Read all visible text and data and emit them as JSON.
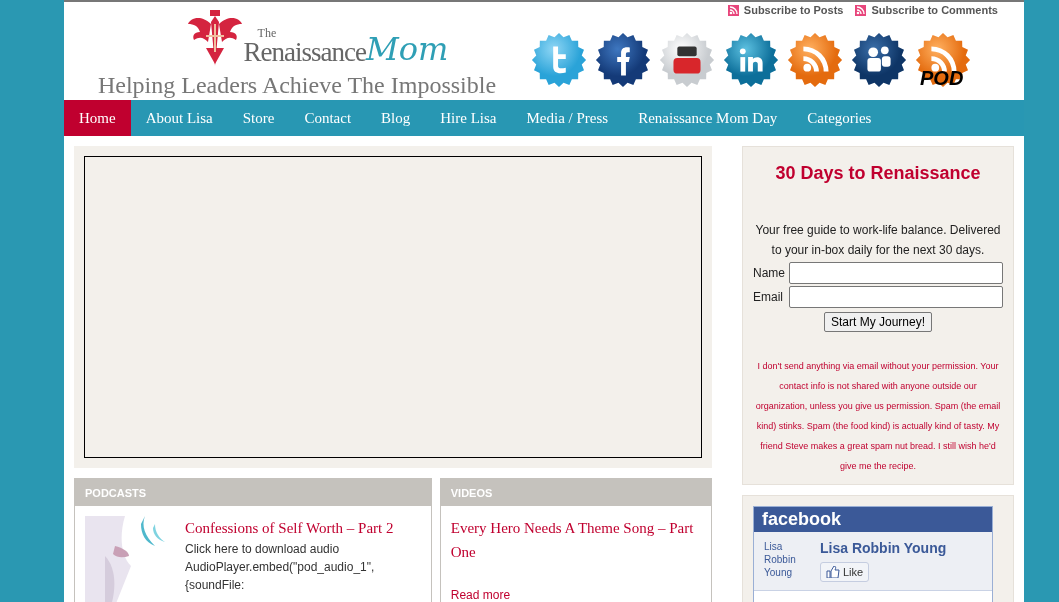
{
  "header": {
    "subscribe_links": [
      "Subscribe to Posts",
      "Subscribe to Comments"
    ],
    "logo": {
      "small": "The",
      "main": "Renaissance",
      "script": "Mom"
    },
    "tagline": "Helping Leaders Achieve The Impossible",
    "social_icons": [
      {
        "kind": "twitter"
      },
      {
        "kind": "facebook"
      },
      {
        "kind": "youtube"
      },
      {
        "kind": "linkedin"
      },
      {
        "kind": "rss"
      },
      {
        "kind": "myspace"
      },
      {
        "kind": "podcast",
        "label": "POD"
      }
    ]
  },
  "nav": [
    {
      "label": "Home",
      "selected": true
    },
    {
      "label": "About Lisa",
      "selected": false
    },
    {
      "label": "Store",
      "selected": false
    },
    {
      "label": "Contact",
      "selected": false
    },
    {
      "label": "Blog",
      "selected": false
    },
    {
      "label": "Hire Lisa",
      "selected": false
    },
    {
      "label": "Media / Press",
      "selected": false
    },
    {
      "label": "Renaissance Mom Day",
      "selected": false
    },
    {
      "label": "Categories",
      "selected": false
    }
  ],
  "podcasts": {
    "heading": "PODCASTS",
    "title": "Confessions of Self Worth – Part 2",
    "lines": [
      "Click here to download audio",
      "AudioPlayer.embed(\"pod_audio_1\",",
      "{soundFile:"
    ]
  },
  "videos": {
    "heading": "VIDEOS",
    "title": "Every Hero Needs A Theme Song – Part One",
    "link": "Read more"
  },
  "signup": {
    "title": "30 Days to Renaissance",
    "intro": "Your free guide to work-life balance. Delivered to your in-box daily for the next 30 days.",
    "fields": [
      {
        "label": "Name"
      },
      {
        "label": "Email"
      }
    ],
    "button": "Start My Journey!",
    "privacy": "I don't send anything via email without your permission. Your contact info is not shared with anyone outside our organization, unless you give us permission. Spam (the email kind) stinks. Spam (the food kind) is actually kind of tasty. My friend Steve makes a great spam nut bread. I still wish he'd give me the recipe."
  },
  "facebook": {
    "brand": "facebook",
    "image_alt": "Lisa Robbin Young",
    "page_name": "Lisa Robbin Young",
    "like": "Like"
  }
}
